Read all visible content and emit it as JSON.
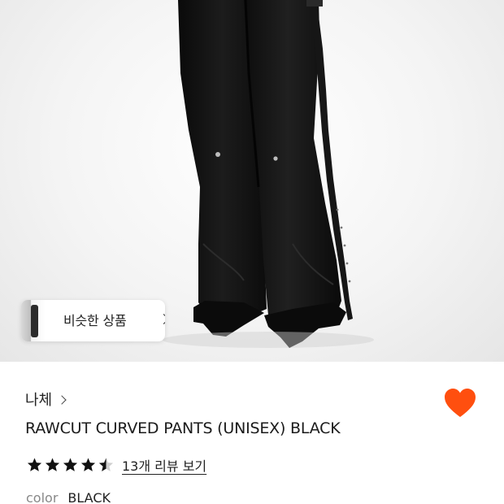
{
  "hero": {
    "image_name": "product-photo-black-curved-pants"
  },
  "similar": {
    "label": "비슷한 상품"
  },
  "product": {
    "brand": "나체",
    "title": "RAWCUT CURVED PANTS (UNISEX) BLACK",
    "rating_out_of_5": 4.5,
    "review_link": "13개 리뷰 보기",
    "option_label": "color",
    "option_value": "BLACK"
  },
  "colors": {
    "wish_heart": "#ff4f0f",
    "text": "#222222",
    "muted": "#888888",
    "star": "#111111"
  },
  "icons": {
    "wish": "heart-icon",
    "brand_chevron": "chevron-right-icon",
    "similar_chevron": "chevron-right-icon",
    "star": "star-icon"
  }
}
